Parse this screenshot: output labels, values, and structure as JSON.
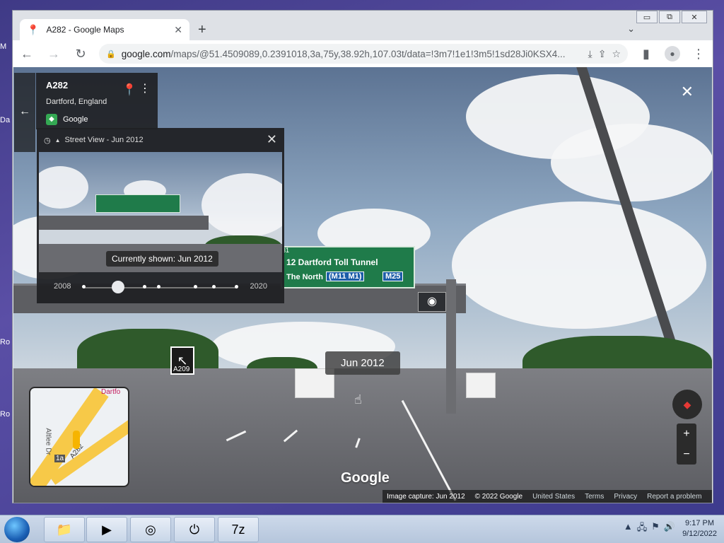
{
  "desktop_labels": [
    "M",
    "Da",
    "Ro",
    "Ro"
  ],
  "window_controls": [
    "▭",
    "⧉",
    "✕"
  ],
  "browser": {
    "tab_title": "A282 - Google Maps",
    "tab_close": "✕",
    "new_tab": "+",
    "tab_list": "⌄",
    "url_domain": "google.com",
    "url_path": "/maps/@51.4509089,0.2391018,3a,75y,38.92h,107.03t/data=!3m7!1e1!3m5!1sd28Ji0KSX4...",
    "icons": {
      "back": "←",
      "forward": "→",
      "reload": "↻",
      "lock": "🔒",
      "install": "⤓",
      "share": "⇪",
      "star": "☆",
      "sidepanel": "▮",
      "profile": "●",
      "menu": "⋮"
    }
  },
  "street_view": {
    "place": {
      "title": "A282",
      "subtitle": "Dartford, England",
      "source": "Google"
    },
    "time_panel": {
      "header": "Street View - Jun 2012",
      "tooltip": "Currently shown: Jun 2012",
      "year_start": "2008",
      "year_end": "2020",
      "selected_fraction": 0.18
    },
    "date_chip": "Jun 2012",
    "scene": {
      "sign_top": "31",
      "sign_line1": "12 Dartford Toll Tunnel",
      "sign_north": "The North",
      "sign_m11": "(M11 M1)",
      "sign_m25": "M25",
      "roadside_sign": "A209"
    },
    "minimap": {
      "label_top": "Dartfo",
      "label_road": "A282",
      "label_side": "Altlee Dr",
      "label_badge": "1a"
    },
    "watermark": "Google",
    "footer": {
      "capture": "Image capture: Jun 2012",
      "copyright": "© 2022 Google",
      "country": "United States",
      "terms": "Terms",
      "privacy": "Privacy",
      "report": "Report a problem"
    },
    "zoom_in": "+",
    "zoom_out": "−"
  },
  "taskbar": {
    "apps": [
      "explorer",
      "media-player",
      "chrome",
      "power",
      "7zip"
    ],
    "time": "9:17 PM",
    "date": "9/12/2022"
  }
}
